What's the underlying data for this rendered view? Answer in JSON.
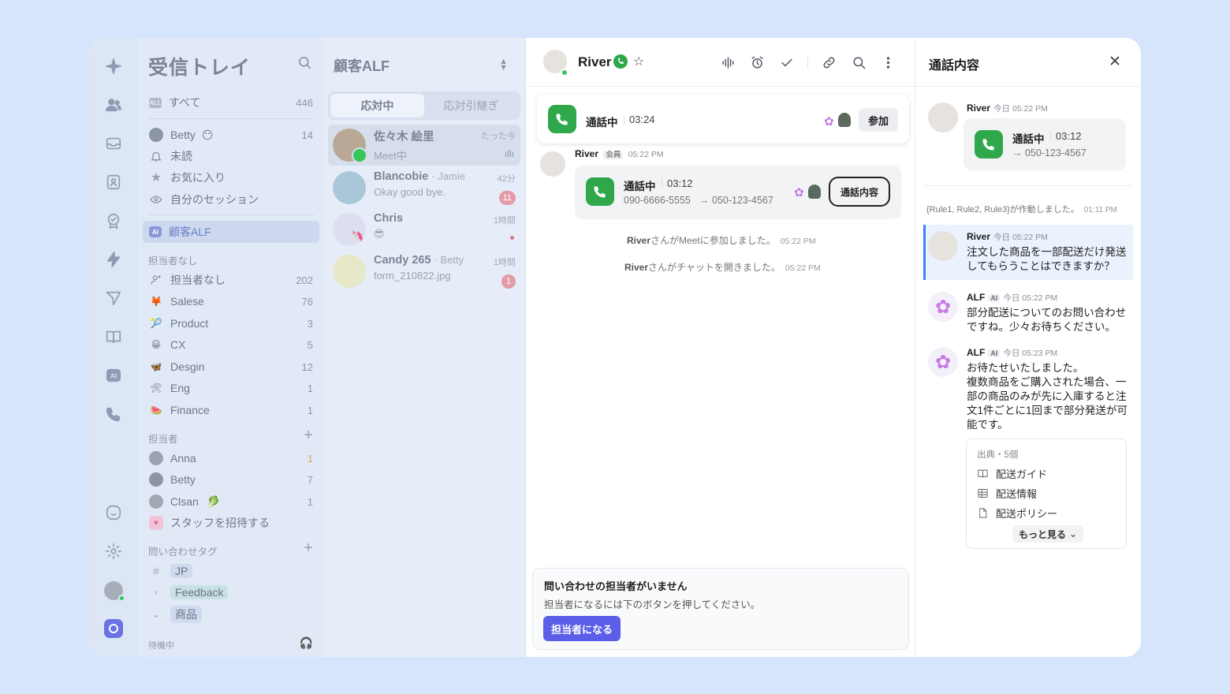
{
  "inbox": {
    "title": "受信トレイ",
    "all": {
      "label": "すべて",
      "count": "446"
    },
    "betty": {
      "label": "Betty",
      "count": "14"
    },
    "unread": {
      "label": "未読"
    },
    "favorites": {
      "label": "お気に入り"
    },
    "my_sessions": {
      "label": "自分のセッション"
    },
    "alf": {
      "label": "顧客ALF",
      "icon_text": "AI"
    },
    "unassigned_section": "担当者なし",
    "groups": [
      {
        "label": "担当者なし",
        "count": "202"
      },
      {
        "label": "Salese",
        "count": "76"
      },
      {
        "label": "Product",
        "count": "3"
      },
      {
        "label": "CX",
        "count": "5"
      },
      {
        "label": "Desgin",
        "count": "12"
      },
      {
        "label": "Eng",
        "count": "1"
      },
      {
        "label": "Finance",
        "count": "1"
      }
    ],
    "assignee_section": "担当者",
    "assignees": [
      {
        "label": "Anna",
        "count": "1"
      },
      {
        "label": "Betty",
        "count": "7"
      },
      {
        "label": "Clsan",
        "count": "1"
      }
    ],
    "invite": "スタッフを招待する",
    "tags_section": "問い合わせタグ",
    "tags": [
      "JP",
      "Feedback",
      "商品"
    ],
    "tag_hash": "#",
    "status": "待機中"
  },
  "list": {
    "title": "顧客ALF",
    "tab_active": "応対中",
    "tab_other": "応対引継ぎ",
    "items": [
      {
        "name": "佐々木 絵里",
        "sub": "",
        "msg": "Meet中",
        "time": "たった今",
        "badge": ""
      },
      {
        "name": "Blancobie",
        "sub": "· Jamie",
        "msg": "Okay good bye.",
        "time": "42分",
        "badge": "11"
      },
      {
        "name": "Chris",
        "sub": "",
        "msg": "😎",
        "time": "1時間",
        "badge": ""
      },
      {
        "name": "Candy 265",
        "sub": "· Betty",
        "msg": "form_210822.jpg",
        "time": "1時間",
        "badge": "1"
      }
    ]
  },
  "chat": {
    "name": "River",
    "callbar": {
      "status": "通話中",
      "time": "03:24",
      "join": "参加"
    },
    "msg": {
      "who": "River",
      "tag": "会員",
      "time": "05:22 PM"
    },
    "card": {
      "status": "通話中",
      "time": "03:12",
      "from": "090-6666-5555",
      "to": "→ 050-123-4567",
      "button": "通話内容"
    },
    "sys1": {
      "name": "River",
      "text": "さんがMeetに参加しました。",
      "time": "05:22 PM"
    },
    "sys2": {
      "name": "River",
      "text": "さんがチャットを開きました。",
      "time": "05:22 PM"
    },
    "assign": {
      "title": "問い合わせの担当者がいません",
      "desc": "担当者になるには下のボタンを押してください。",
      "button": "担当者になる"
    }
  },
  "panel": {
    "title": "通話内容",
    "m1": {
      "who": "River",
      "time": "今日 05:22 PM",
      "status": "通話中",
      "dur": "03:12",
      "to": "→ 050-123-4567"
    },
    "rule": {
      "text": "{Rule1, Rule2, Rule3}が作動しました。",
      "time": "01:11 PM"
    },
    "m2": {
      "who": "River",
      "time": "今日 05:22 PM",
      "text": "注文した商品を一部配送だけ発送してもらうことはできますか？"
    },
    "m3": {
      "who": "ALF",
      "ai": "AI",
      "time": "今日 05:22 PM",
      "text": "部分配送についてのお問い合わせですね。少々お待ちください。"
    },
    "m4": {
      "who": "ALF",
      "ai": "AI",
      "time": "今日 05:23 PM",
      "text1": "お待たせいたしました。",
      "text2": "複数商品をご購入された場合、一部の商品のみが先に入庫すると注文1件ごとに1回まで部分発送が可能です。"
    },
    "sources": {
      "header": "出典・5個",
      "items": [
        "配送ガイド",
        "配送情報",
        "配送ポリシー"
      ],
      "more": "もっと見る"
    }
  },
  "colors": {
    "accent": "#5b5fe8",
    "call_green": "#2ea84a",
    "background": "#d6e4fc"
  }
}
